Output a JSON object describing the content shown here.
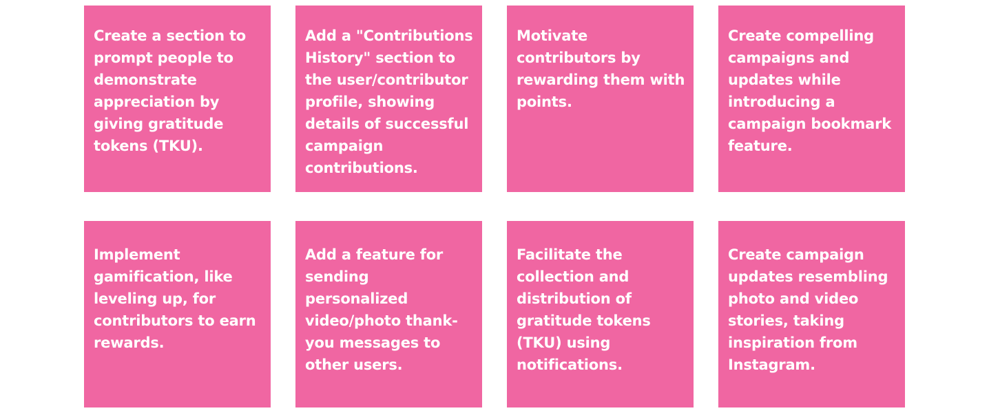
{
  "colors": {
    "note_background": "#f066a2",
    "note_text": "#ffffff",
    "page_background": "#ffffff"
  },
  "notes": [
    {
      "text": "Create a section to prompt people to demonstrate appreciation by giving gratitude tokens (TKU)."
    },
    {
      "text": "Add a \"Contributions History\" section to the user/contributor profile, showing details of successful campaign contributions."
    },
    {
      "text": "Motivate contributors by rewarding them with points."
    },
    {
      "text": "Create compelling campaigns and updates while introducing a campaign bookmark feature."
    },
    {
      "text": "Implement gamification, like leveling up, for contributors to earn rewards."
    },
    {
      "text": "Add a feature for sending personalized video/photo thank-you messages to other users."
    },
    {
      "text": "Facilitate the collection and distribution of gratitude tokens (TKU) using notifications."
    },
    {
      "text": "Create campaign updates resembling photo and video stories, taking inspiration from Instagram."
    }
  ]
}
